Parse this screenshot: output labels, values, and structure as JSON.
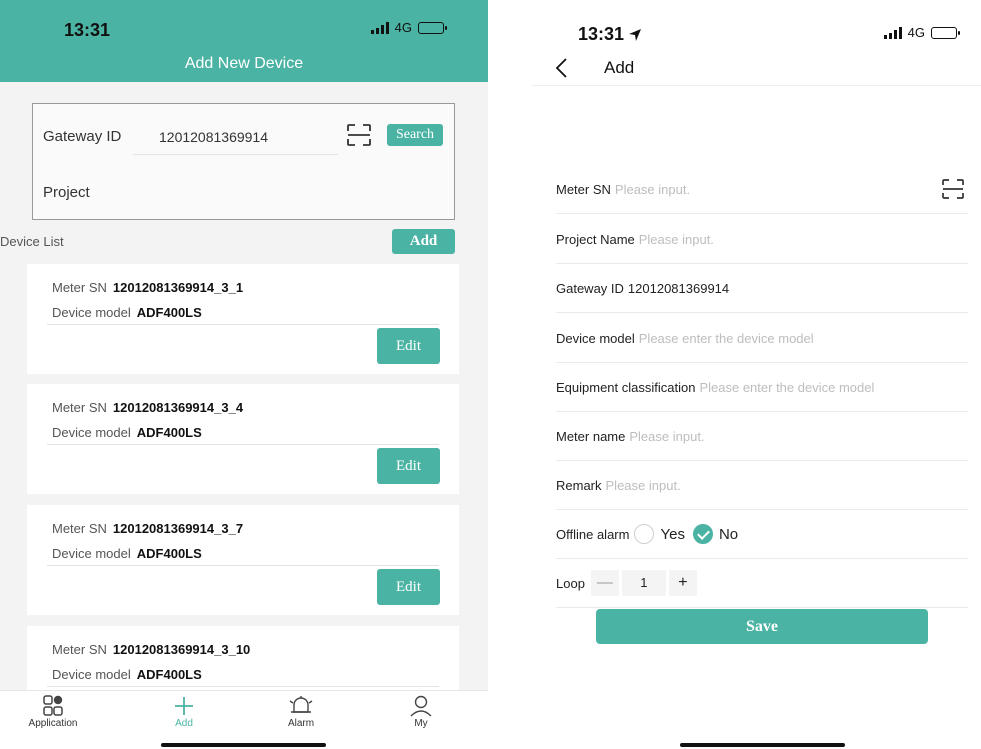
{
  "left": {
    "status": {
      "time": "13:31",
      "network": "4G"
    },
    "header": {
      "title": "Add New Device"
    },
    "gateway": {
      "label": "Gateway ID",
      "value": "12012081369914",
      "search_label": "Search",
      "project_label": "Project"
    },
    "device_list": {
      "label": "Device List",
      "add_label": "Add",
      "meter_sn_label": "Meter SN",
      "device_model_label": "Device model",
      "edit_label": "Edit",
      "items": [
        {
          "meter_sn": "12012081369914_3_1",
          "device_model": "ADF400LS"
        },
        {
          "meter_sn": "12012081369914_3_4",
          "device_model": "ADF400LS"
        },
        {
          "meter_sn": "12012081369914_3_7",
          "device_model": "ADF400LS"
        },
        {
          "meter_sn": "12012081369914_3_10",
          "device_model": "ADF400LS"
        }
      ]
    },
    "tabbar": {
      "items": [
        {
          "label": "Application",
          "icon": "application-icon"
        },
        {
          "label": "Add",
          "icon": "plus-icon",
          "active": true
        },
        {
          "label": "Alarm",
          "icon": "bell-icon"
        },
        {
          "label": "My",
          "icon": "user-icon"
        }
      ]
    }
  },
  "right": {
    "status": {
      "time": "13:31",
      "network": "4G"
    },
    "nav": {
      "title": "Add"
    },
    "form": {
      "meter_sn": {
        "label": "Meter SN",
        "placeholder": "Please input."
      },
      "project_name": {
        "label": "Project Name",
        "placeholder": "Please input."
      },
      "gateway_id": {
        "label": "Gateway ID",
        "value": "12012081369914"
      },
      "device_model": {
        "label": "Device model",
        "placeholder": "Please enter the device model"
      },
      "equipment_classification": {
        "label": "Equipment classification",
        "placeholder": "Please enter the device model"
      },
      "meter_name": {
        "label": "Meter name",
        "placeholder": "Please input."
      },
      "remark": {
        "label": "Remark",
        "placeholder": "Please input."
      },
      "offline_alarm": {
        "label": "Offline alarm",
        "yes": "Yes",
        "no": "No",
        "selected": "No"
      },
      "loop": {
        "label": "Loop",
        "minus": "—",
        "value": "1",
        "plus": "+"
      }
    },
    "save_label": "Save"
  },
  "colors": {
    "accent": "#4bb3a3",
    "placeholder": "#bdbdbd"
  }
}
